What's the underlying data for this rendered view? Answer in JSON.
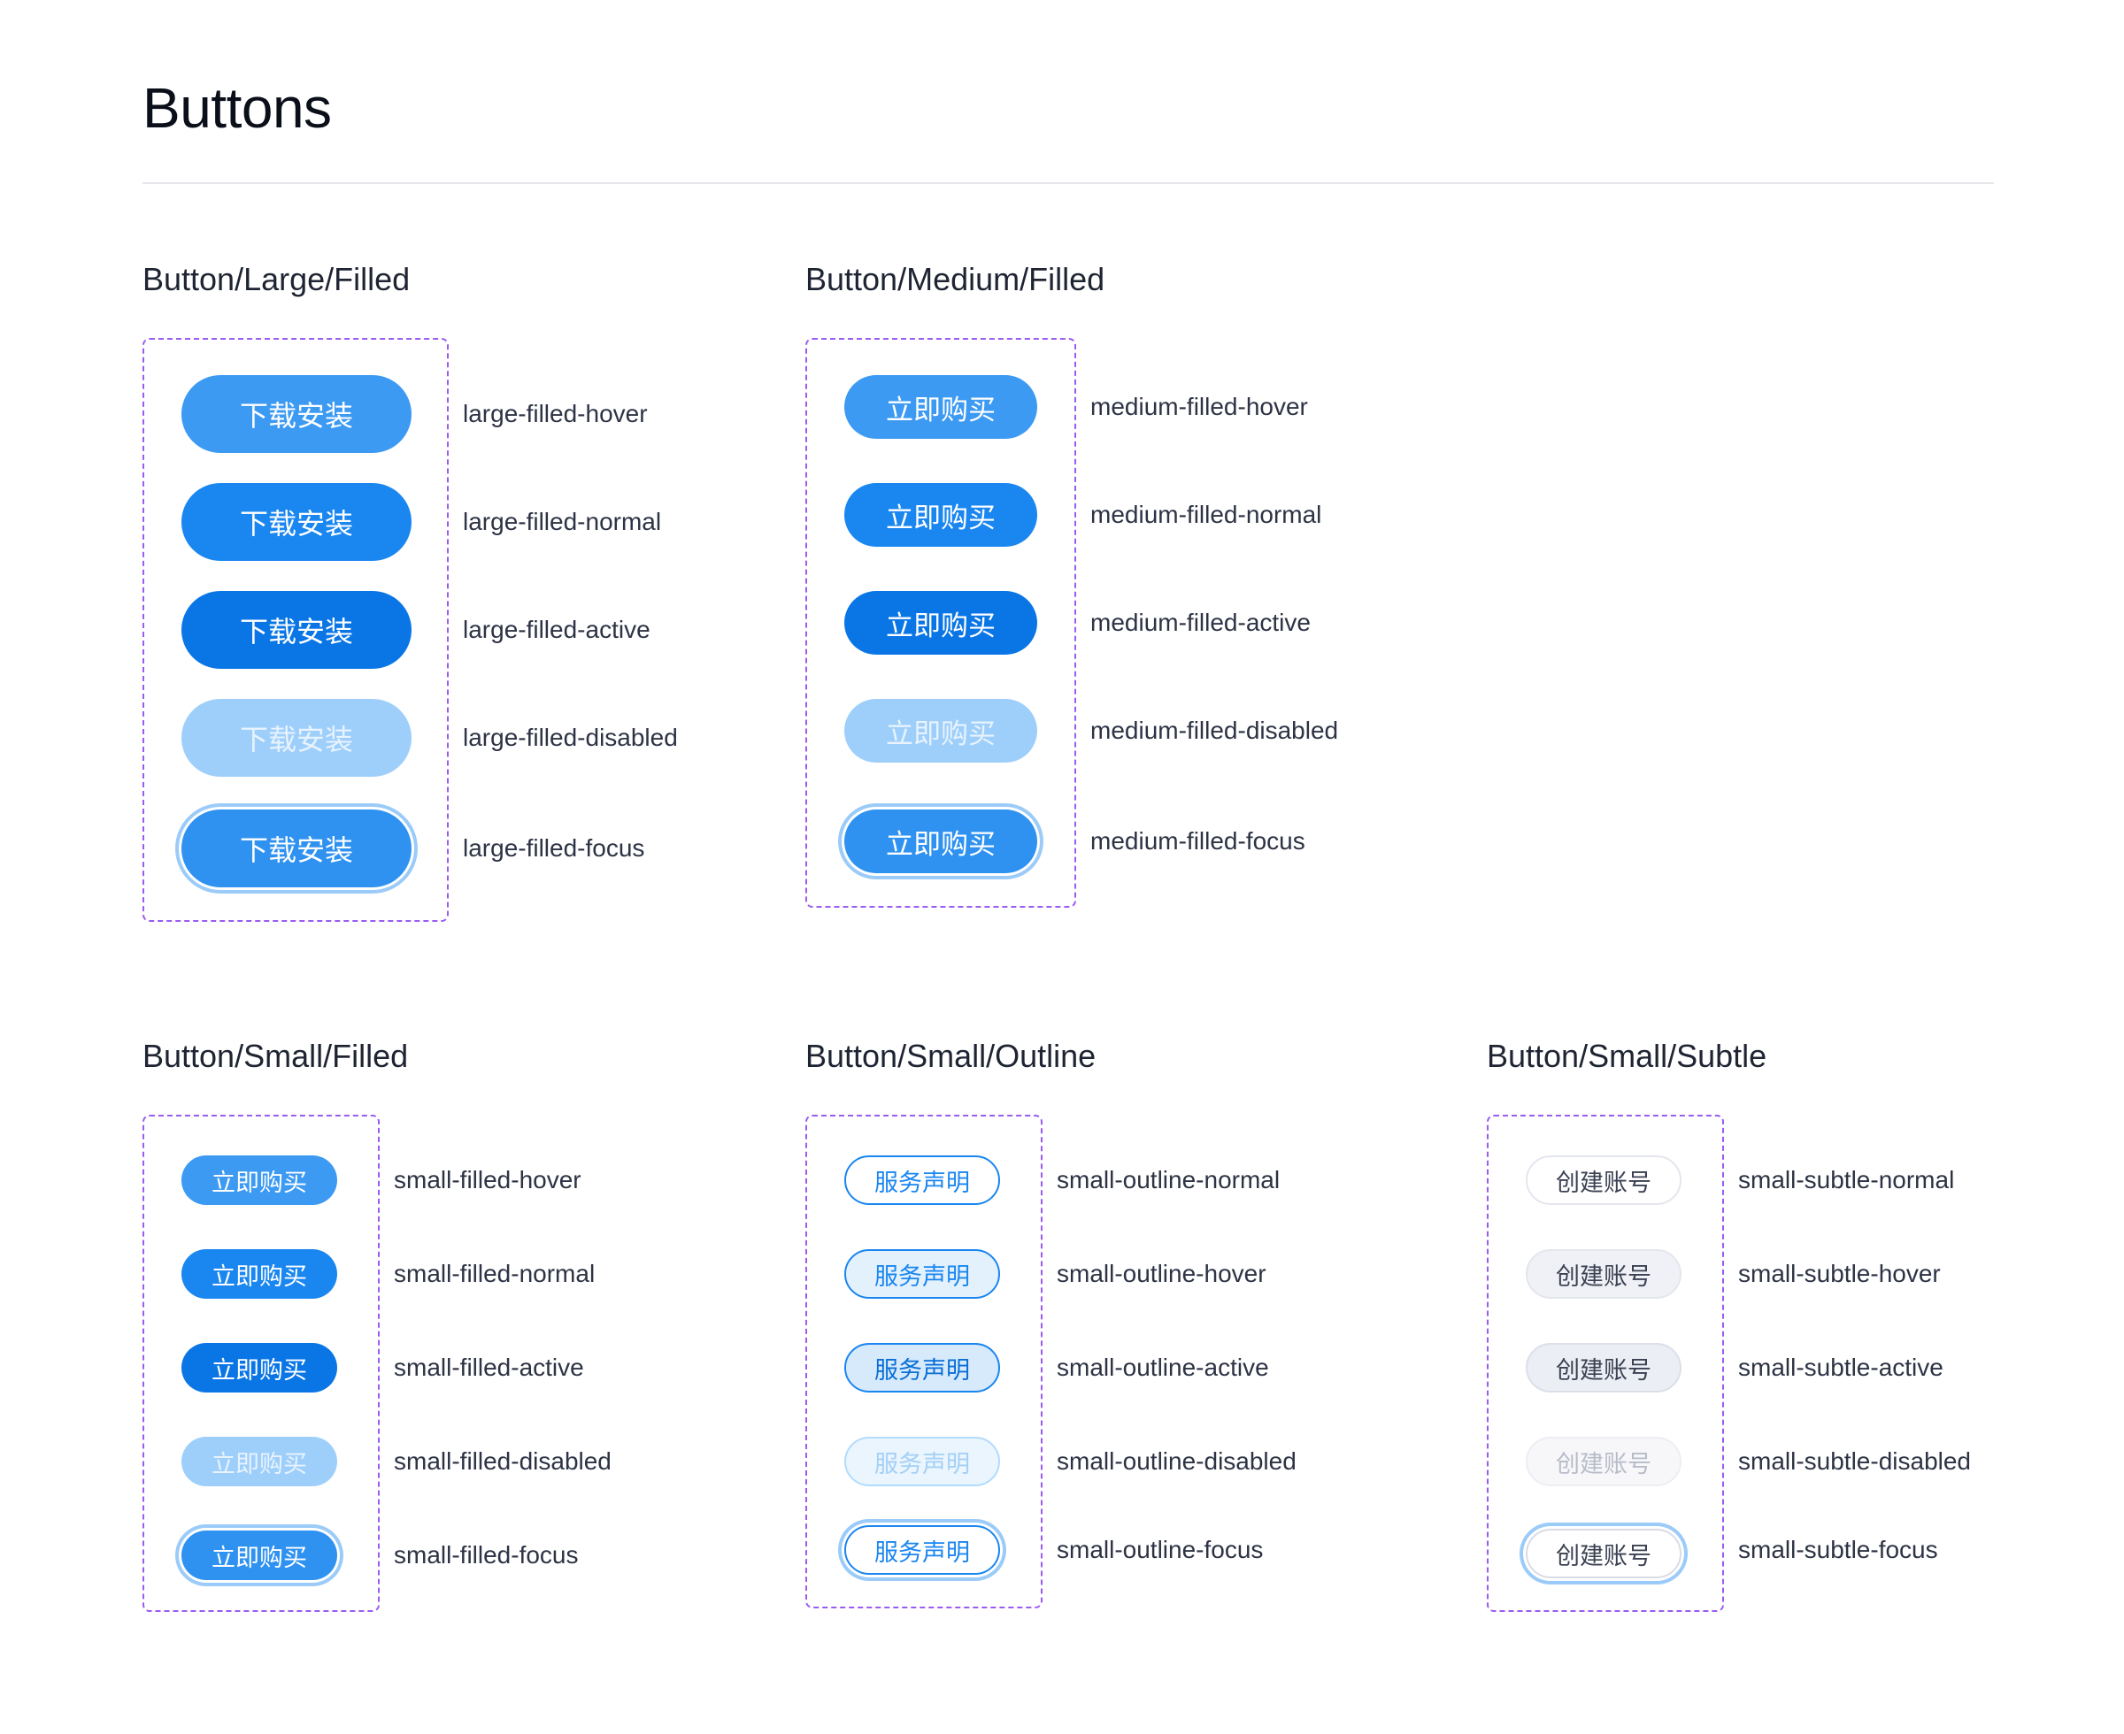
{
  "page": {
    "title": "Buttons"
  },
  "colors": {
    "primary": "#1a86f0",
    "frame_border": "#9a5bf0",
    "focus_ring": "#9bcbf8"
  },
  "sections": {
    "large_filled": {
      "title": "Button/Large/Filled",
      "button_text": "下载安装",
      "states": [
        "large-filled-hover",
        "large-filled-normal",
        "large-filled-active",
        "large-filled-disabled",
        "large-filled-focus"
      ]
    },
    "medium_filled": {
      "title": "Button/Medium/Filled",
      "button_text": "立即购买",
      "states": [
        "medium-filled-hover",
        "medium-filled-normal",
        "medium-filled-active",
        "medium-filled-disabled",
        "medium-filled-focus"
      ]
    },
    "small_filled": {
      "title": "Button/Small/Filled",
      "button_text": "立即购买",
      "states": [
        "small-filled-hover",
        "small-filled-normal",
        "small-filled-active",
        "small-filled-disabled",
        "small-filled-focus"
      ]
    },
    "small_outline": {
      "title": "Button/Small/Outline",
      "button_text": "服务声明",
      "states": [
        "small-outline-normal",
        "small-outline-hover",
        "small-outline-active",
        "small-outline-disabled",
        "small-outline-focus"
      ]
    },
    "small_subtle": {
      "title": "Button/Small/Subtle",
      "button_text": "创建账号",
      "states": [
        "small-subtle-normal",
        "small-subtle-hover",
        "small-subtle-active",
        "small-subtle-disabled",
        "small-subtle-focus"
      ]
    }
  }
}
